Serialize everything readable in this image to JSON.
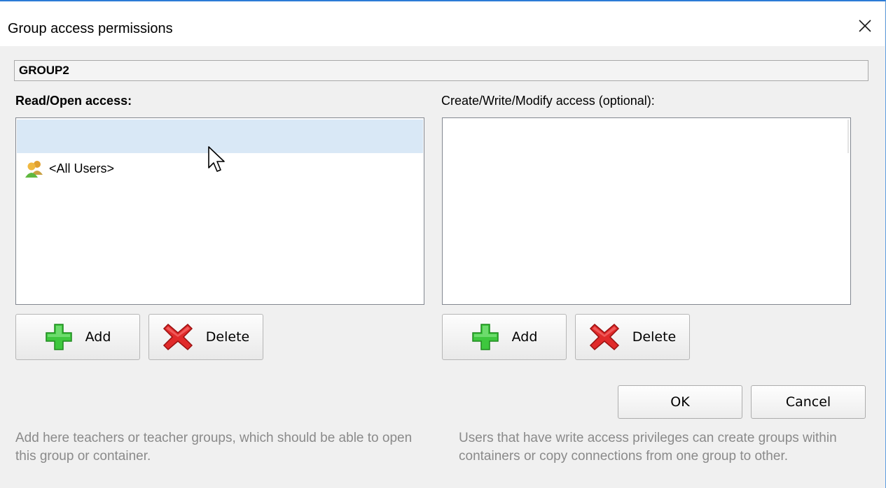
{
  "window": {
    "title": "Group access permissions",
    "close_label": "Close"
  },
  "group_name": "GROUP2",
  "read_access": {
    "label": "Read/Open access:",
    "items": [
      {
        "name": "<All Users>",
        "icon": "users-group-icon"
      }
    ],
    "add_label": "Add",
    "delete_label": "Delete"
  },
  "write_access": {
    "label": "Create/Write/Modify access (optional):",
    "items": [],
    "add_label": "Add",
    "delete_label": "Delete"
  },
  "dialog_buttons": {
    "ok_label": "OK",
    "cancel_label": "Cancel"
  },
  "help": {
    "read": "Add here teachers or teacher groups, which should be able to open this group or container.",
    "write": "Users that have write access privileges can create groups within containers or copy connections from one group to other."
  },
  "colors": {
    "accent_border": "#2b7bd6",
    "hover_row": "#d9e8f6",
    "add_icon": "#3ec73e",
    "delete_icon": "#e02a2a",
    "help_text": "#8a8a8a"
  }
}
